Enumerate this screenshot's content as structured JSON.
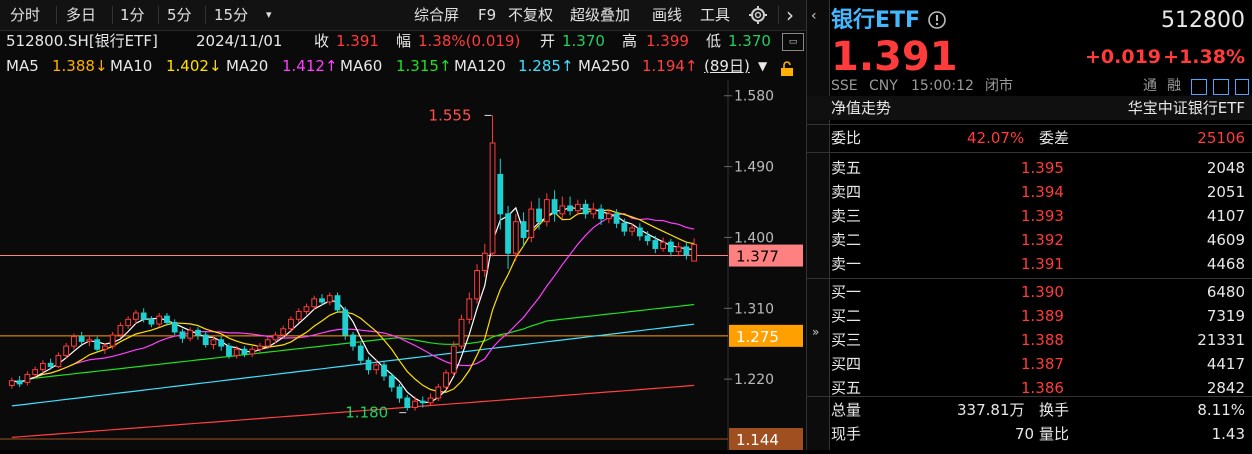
{
  "toolbar": {
    "items": [
      "分时",
      "多日",
      "1分",
      "5分",
      "15分",
      "▾",
      "综合屏",
      "F9",
      "不复权",
      "超级叠加",
      "画线",
      "工具"
    ],
    "next_arrow": "›"
  },
  "info": {
    "code": "512800.SH[银行ETF]",
    "date": "2024/11/01",
    "close_label": "收",
    "close": "1.391",
    "amp_label": "幅",
    "amp": "1.38%(0.019)",
    "open_label": "开",
    "open": "1.370",
    "high_label": "高",
    "high": "1.399",
    "low_label": "低",
    "low": "1.370"
  },
  "ma": {
    "ma5": "MA5",
    "ma5_val": "1.388↓",
    "ma10": "MA10",
    "ma10_val": "1.402↓",
    "ma20": "MA20",
    "ma20_val": "1.412↑",
    "ma60": "MA60",
    "ma60_val": "1.315↑",
    "ma120": "MA120",
    "ma120_val": "1.285↑",
    "ma250": "MA250",
    "ma250_val": "1.194↑",
    "period": "(89日)"
  },
  "chart_data": {
    "type": "candlestick",
    "ylim": [
      1.13,
      1.6
    ],
    "y_ticks": [
      "1.580",
      "1.490",
      "1.400",
      "1.310",
      "1.220"
    ],
    "markers": {
      "high": "1.555",
      "low": "1.180"
    },
    "price_lines": [
      {
        "value": 1.377,
        "label": "1.377",
        "color": "#ff8080"
      },
      {
        "value": 1.275,
        "label": "1.275",
        "color": "#ffa000"
      },
      {
        "value": 1.144,
        "label": "1.144",
        "color": "#a05020"
      }
    ],
    "candles": [
      [
        1.212,
        1.218,
        1.208,
        1.222
      ],
      [
        1.218,
        1.214,
        1.21,
        1.224
      ],
      [
        1.216,
        1.226,
        1.212,
        1.23
      ],
      [
        1.226,
        1.232,
        1.222,
        1.236
      ],
      [
        1.232,
        1.24,
        1.228,
        1.244
      ],
      [
        1.24,
        1.236,
        1.232,
        1.246
      ],
      [
        1.236,
        1.25,
        1.234,
        1.254
      ],
      [
        1.25,
        1.262,
        1.246,
        1.266
      ],
      [
        1.262,
        1.274,
        1.258,
        1.278
      ],
      [
        1.274,
        1.268,
        1.264,
        1.28
      ],
      [
        1.268,
        1.27,
        1.262,
        1.276
      ],
      [
        1.27,
        1.258,
        1.254,
        1.274
      ],
      [
        1.258,
        1.262,
        1.252,
        1.266
      ],
      [
        1.262,
        1.276,
        1.258,
        1.28
      ],
      [
        1.276,
        1.288,
        1.272,
        1.292
      ],
      [
        1.288,
        1.296,
        1.284,
        1.3
      ],
      [
        1.296,
        1.304,
        1.29,
        1.308
      ],
      [
        1.304,
        1.296,
        1.292,
        1.31
      ],
      [
        1.296,
        1.29,
        1.286,
        1.3
      ],
      [
        1.29,
        1.3,
        1.286,
        1.304
      ],
      [
        1.3,
        1.292,
        1.288,
        1.304
      ],
      [
        1.292,
        1.28,
        1.276,
        1.296
      ],
      [
        1.28,
        1.272,
        1.266,
        1.284
      ],
      [
        1.272,
        1.282,
        1.268,
        1.286
      ],
      [
        1.282,
        1.276,
        1.27,
        1.286
      ],
      [
        1.276,
        1.264,
        1.26,
        1.28
      ],
      [
        1.264,
        1.27,
        1.258,
        1.274
      ],
      [
        1.27,
        1.262,
        1.256,
        1.274
      ],
      [
        1.262,
        1.25,
        1.246,
        1.266
      ],
      [
        1.25,
        1.258,
        1.246,
        1.262
      ],
      [
        1.258,
        1.252,
        1.248,
        1.262
      ],
      [
        1.252,
        1.258,
        1.248,
        1.262
      ],
      [
        1.258,
        1.262,
        1.254,
        1.266
      ],
      [
        1.262,
        1.27,
        1.258,
        1.274
      ],
      [
        1.27,
        1.276,
        1.266,
        1.28
      ],
      [
        1.276,
        1.284,
        1.272,
        1.288
      ],
      [
        1.284,
        1.296,
        1.28,
        1.3
      ],
      [
        1.296,
        1.306,
        1.292,
        1.31
      ],
      [
        1.306,
        1.312,
        1.302,
        1.316
      ],
      [
        1.312,
        1.322,
        1.308,
        1.326
      ],
      [
        1.322,
        1.318,
        1.314,
        1.328
      ],
      [
        1.318,
        1.326,
        1.314,
        1.33
      ],
      [
        1.326,
        1.308,
        1.304,
        1.33
      ],
      [
        1.308,
        1.276,
        1.27,
        1.312
      ],
      [
        1.276,
        1.262,
        1.256,
        1.28
      ],
      [
        1.262,
        1.244,
        1.238,
        1.266
      ],
      [
        1.244,
        1.232,
        1.226,
        1.248
      ],
      [
        1.232,
        1.238,
        1.226,
        1.244
      ],
      [
        1.238,
        1.224,
        1.218,
        1.242
      ],
      [
        1.224,
        1.21,
        1.204,
        1.228
      ],
      [
        1.21,
        1.196,
        1.19,
        1.214
      ],
      [
        1.196,
        1.184,
        1.18,
        1.2
      ],
      [
        1.184,
        1.192,
        1.18,
        1.198
      ],
      [
        1.192,
        1.19,
        1.184,
        1.198
      ],
      [
        1.19,
        1.196,
        1.186,
        1.202
      ],
      [
        1.196,
        1.21,
        1.192,
        1.214
      ],
      [
        1.21,
        1.228,
        1.206,
        1.232
      ],
      [
        1.228,
        1.262,
        1.224,
        1.268
      ],
      [
        1.262,
        1.296,
        1.258,
        1.302
      ],
      [
        1.296,
        1.322,
        1.29,
        1.33
      ],
      [
        1.322,
        1.358,
        1.316,
        1.366
      ],
      [
        1.358,
        1.38,
        1.35,
        1.392
      ],
      [
        1.38,
        1.52,
        1.376,
        1.555
      ],
      [
        1.48,
        1.43,
        1.41,
        1.5
      ],
      [
        1.43,
        1.38,
        1.36,
        1.44
      ],
      [
        1.38,
        1.42,
        1.37,
        1.43
      ],
      [
        1.42,
        1.4,
        1.388,
        1.432
      ],
      [
        1.4,
        1.436,
        1.394,
        1.446
      ],
      [
        1.436,
        1.42,
        1.41,
        1.45
      ],
      [
        1.42,
        1.448,
        1.414,
        1.456
      ],
      [
        1.448,
        1.43,
        1.42,
        1.46
      ],
      [
        1.43,
        1.44,
        1.424,
        1.452
      ],
      [
        1.44,
        1.434,
        1.428,
        1.452
      ],
      [
        1.434,
        1.442,
        1.428,
        1.448
      ],
      [
        1.442,
        1.43,
        1.424,
        1.448
      ],
      [
        1.43,
        1.436,
        1.424,
        1.444
      ],
      [
        1.436,
        1.424,
        1.416,
        1.442
      ],
      [
        1.424,
        1.43,
        1.418,
        1.436
      ],
      [
        1.43,
        1.418,
        1.412,
        1.436
      ],
      [
        1.418,
        1.408,
        1.402,
        1.424
      ],
      [
        1.408,
        1.412,
        1.402,
        1.418
      ],
      [
        1.412,
        1.402,
        1.396,
        1.418
      ],
      [
        1.402,
        1.396,
        1.39,
        1.408
      ],
      [
        1.396,
        1.386,
        1.38,
        1.402
      ],
      [
        1.386,
        1.394,
        1.382,
        1.4
      ],
      [
        1.394,
        1.382,
        1.376,
        1.398
      ],
      [
        1.382,
        1.388,
        1.376,
        1.394
      ],
      [
        1.388,
        1.378,
        1.372,
        1.394
      ],
      [
        1.37,
        1.391,
        1.37,
        1.399
      ]
    ],
    "ma_colors": {
      "ma5": "#ffffff",
      "ma10": "#ffe000",
      "ma20": "#ff40ff",
      "ma60": "#20e020",
      "ma120": "#40e0ff",
      "ma250": "#ff4040"
    }
  },
  "quote": {
    "name": "银行ETF",
    "code": "512800",
    "price": "1.391",
    "change": "+0.019",
    "change_pct": "+1.38%",
    "exchange": "SSE",
    "currency": "CNY",
    "time": "15:00:12",
    "status": "闭市",
    "tags": [
      "通",
      "融"
    ],
    "nav_label": "净值走势",
    "index_name": "华宝中证银行ETF",
    "weibi_label": "委比",
    "weibi": "42.07%",
    "weicha_label": "委差",
    "weicha": "25106",
    "asks": [
      {
        "label": "卖五",
        "price": "1.395",
        "vol": "2048"
      },
      {
        "label": "卖四",
        "price": "1.394",
        "vol": "2051"
      },
      {
        "label": "卖三",
        "price": "1.393",
        "vol": "4107"
      },
      {
        "label": "卖二",
        "price": "1.392",
        "vol": "4609"
      },
      {
        "label": "卖一",
        "price": "1.391",
        "vol": "4468"
      }
    ],
    "bids": [
      {
        "label": "买一",
        "price": "1.390",
        "vol": "6480"
      },
      {
        "label": "买二",
        "price": "1.389",
        "vol": "7319"
      },
      {
        "label": "买三",
        "price": "1.388",
        "vol": "21331"
      },
      {
        "label": "买四",
        "price": "1.387",
        "vol": "4417"
      },
      {
        "label": "买五",
        "price": "1.386",
        "vol": "2842"
      }
    ],
    "total_label": "总量",
    "total": "337.81万",
    "turnover_label": "换手",
    "turnover": "8.11%",
    "current_label": "现手",
    "current": "70",
    "volratio_label": "量比",
    "volratio": "1.43"
  },
  "colors": {
    "up": "#ff3b3b",
    "down": "#20d0d0",
    "bg": "#0a0a0a"
  }
}
